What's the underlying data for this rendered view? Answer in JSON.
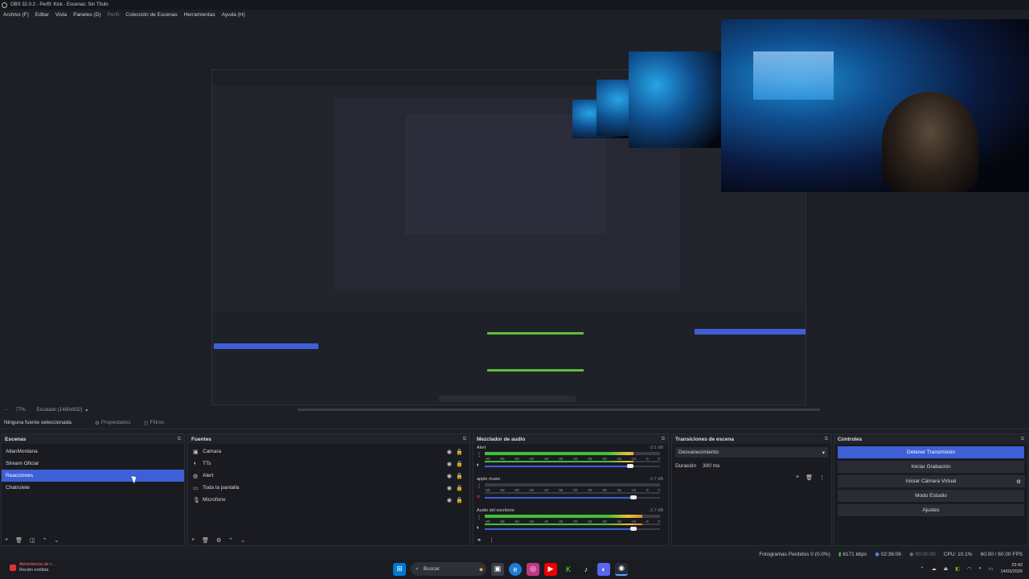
{
  "window": {
    "title": "OBS 32.0.2 - Perfil: Kick - Escenas: Sin Título"
  },
  "menu": [
    "Archivo (F)",
    "Editar",
    "Vista",
    "Paneles (D)",
    "Perfil",
    "Colección de Escenas",
    "Herramientas",
    "Ayuda (H)"
  ],
  "preview": {
    "zoom": "77%",
    "scale": "Escalado (1480x832)"
  },
  "source_bar": {
    "no_source": "Ninguna fuente seleccionada",
    "properties": "Propiedades",
    "filters": "Filtros"
  },
  "scenes": {
    "title": "Escenas",
    "items": [
      "AllanMontana",
      "Stream Oficial",
      "Reacciones",
      "Chatrulete"
    ],
    "selected": "Reacciones"
  },
  "sources": {
    "title": "Fuentes",
    "items": [
      {
        "label": "Camara",
        "icon": "camera-icon"
      },
      {
        "label": "TTs",
        "icon": "speaker-icon"
      },
      {
        "label": "Alert",
        "icon": "globe-icon"
      },
      {
        "label": "Toda la pantalla",
        "icon": "monitor-icon"
      },
      {
        "label": "Microfono",
        "icon": "mic-icon"
      }
    ]
  },
  "mixer": {
    "title": "Mezclador de audio",
    "ticks": [
      "-60",
      "-55",
      "-50",
      "-45",
      "-40",
      "-35",
      "-30",
      "-25",
      "-20",
      "-15",
      "-10",
      "-5",
      "0"
    ],
    "channels": [
      {
        "name": "Alert",
        "db": "-3.1 dB",
        "level": 0.85,
        "volume": 0.83,
        "muted": false
      },
      {
        "name": "apple music",
        "db": "-2.7 dB",
        "level": 0.0,
        "volume": 0.85,
        "muted": true
      },
      {
        "name": "Audio del escritorio",
        "db": "-2.7 dB",
        "level": 0.9,
        "volume": 0.85,
        "muted": false
      }
    ]
  },
  "transitions": {
    "title": "Transiciones de escena",
    "selected": "Desvanecimiento",
    "duration_label": "Duración",
    "duration_value": "300 ms"
  },
  "controls": {
    "title": "Controles",
    "buttons": [
      "Detener Transmisión",
      "Iniciar Grabación",
      "Iniciar Cámara Virtual",
      "Modo Estudio",
      "Ajustes"
    ]
  },
  "status": {
    "dropped": "Fotogramas Perdidos 0 (0.0%)",
    "bitrate": "8171 kbps",
    "stream_time": "02:36:06",
    "rec_time": "00:00:00",
    "cpu": "CPU: 10.1%",
    "fps": "60.00 / 60.00 FPS"
  },
  "taskbar": {
    "notification_title": "Advertencia de t...",
    "notification_sub": "Recién emitida",
    "search": "Buscar",
    "time": "23:42",
    "date": "14/03/2026"
  }
}
